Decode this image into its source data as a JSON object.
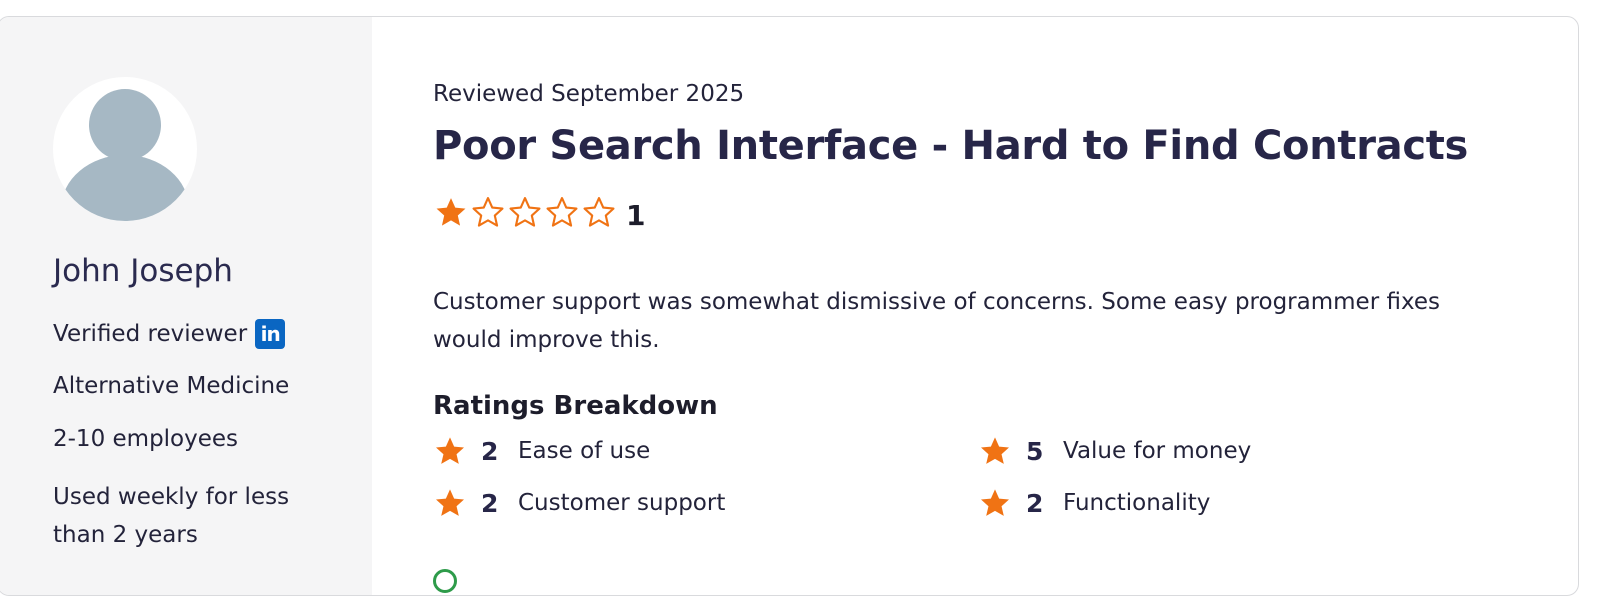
{
  "reviewer": {
    "name": "John Joseph",
    "verified_label": "Verified reviewer",
    "linkedin_icon": "linkedin-icon",
    "linkedin_glyph": "in",
    "industry": "Alternative Medicine",
    "company_size": "2-10 employees",
    "usage": "Used weekly for less than 2 years"
  },
  "review": {
    "date": "Reviewed September 2025",
    "title": "Poor Search Interface - Hard to Find Contracts",
    "overall_rating": 1,
    "overall_rating_max": 5,
    "overall_score_text": "1",
    "body": "Customer support was somewhat dismissive of concerns. Some easy programmer fixes would improve this."
  },
  "breakdown": {
    "title": "Ratings Breakdown",
    "items": [
      {
        "value": "2",
        "label": "Ease of use"
      },
      {
        "value": "5",
        "label": "Value for money"
      },
      {
        "value": "2",
        "label": "Customer support"
      },
      {
        "value": "2",
        "label": "Functionality"
      }
    ]
  },
  "colors": {
    "star": "#f07314",
    "heading": "#272648",
    "sidebar_bg": "#f5f5f6",
    "avatar_silhouette": "#a6b8c4",
    "linkedin": "#0a66c2",
    "positive": "#2e9b4a"
  }
}
